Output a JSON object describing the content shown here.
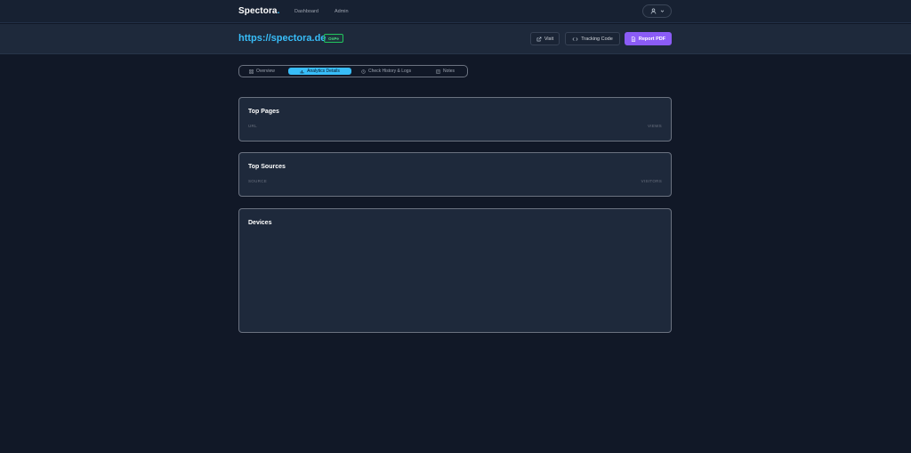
{
  "nav": {
    "brand": "Spectora",
    "brand_dot": ".",
    "links": [
      "Dashboard",
      "Admin"
    ]
  },
  "header": {
    "site_url": "https://spectora.de",
    "status_badge": "OnPe",
    "buttons": {
      "visit": "Visit",
      "tracking_code": "Tracking Code",
      "report_pdf": "Report PDF"
    }
  },
  "tabs": [
    {
      "label": "Overview",
      "active": false
    },
    {
      "label": "Analytics Details",
      "active": true
    },
    {
      "label": "Check History & Logs",
      "active": false
    },
    {
      "label": "Notes",
      "active": false
    }
  ],
  "cards": {
    "top_pages": {
      "title": "Top Pages",
      "col_left": "URL",
      "col_right": "VIEWS"
    },
    "top_sources": {
      "title": "Top Sources",
      "col_left": "SOURCE",
      "col_right": "VISITORS"
    },
    "devices": {
      "title": "Devices"
    }
  },
  "colors": {
    "accent": "#38bdf8",
    "primary_button": "#8b5cf6",
    "status": "#22c55e",
    "background": "#111827",
    "card": "#1e293b"
  },
  "icons": {
    "user": "user-icon",
    "chevron": "chevron-down-icon",
    "visit": "external-link-icon",
    "tracking": "code-icon",
    "report": "file-icon",
    "overview": "grid-icon",
    "analytics": "bar-chart-icon",
    "history": "clock-icon",
    "notes": "notes-icon"
  }
}
